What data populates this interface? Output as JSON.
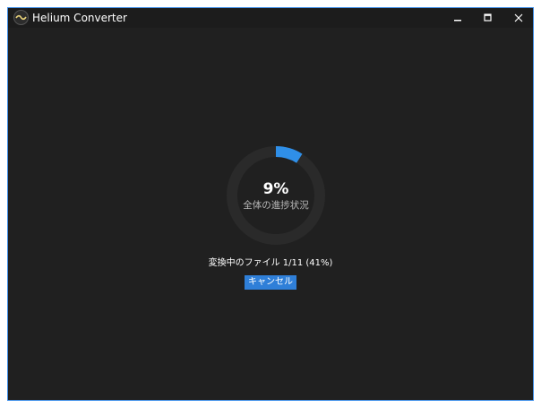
{
  "window": {
    "title": "Helium Converter",
    "controls": {
      "minimize": "minimize-icon",
      "maximize": "maximize-icon",
      "close": "close-icon"
    }
  },
  "progress": {
    "percent_text": "9%",
    "percent_value": 9,
    "label": "全体の進捗状況"
  },
  "status": {
    "file_progress": "変換中のファイル 1/11 (41%)"
  },
  "actions": {
    "cancel_label": "キャンセル"
  },
  "colors": {
    "background": "#202020",
    "titlebar": "#1c1c1c",
    "accent": "#2f8fe8",
    "ring_track": "#2a2a2a",
    "window_border": "#3d8ee8"
  }
}
